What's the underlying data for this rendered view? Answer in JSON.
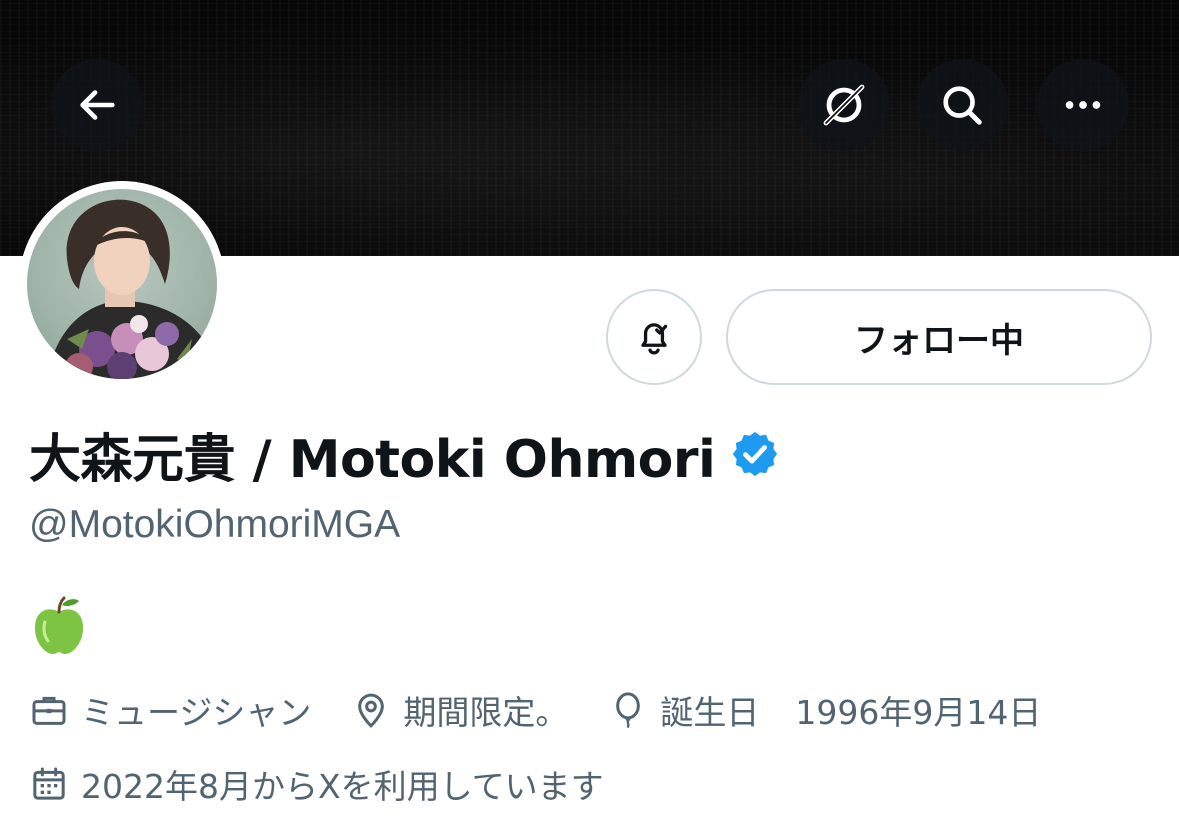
{
  "profile": {
    "display_name": "大森元貴 / Motoki Ohmori",
    "handle": "@MotokiOhmoriMGA",
    "verified": true,
    "bio_emoji": "🍏",
    "follow_button_label": "フォロー中",
    "profession": "ミュージシャン",
    "location": "期間限定。",
    "birthday_label": "誕生日",
    "birthday_value": "1996年9月14日",
    "joined": "2022年8月からXを利用しています"
  },
  "header": {
    "icons": [
      "back-arrow-icon",
      "grok-icon",
      "search-icon",
      "more-icon"
    ]
  },
  "colors": {
    "banner": "#070707",
    "verified_blue": "#1d9bf0",
    "secondary_text": "#536471",
    "primary_text": "#0f1419",
    "border": "#cfd9de"
  }
}
